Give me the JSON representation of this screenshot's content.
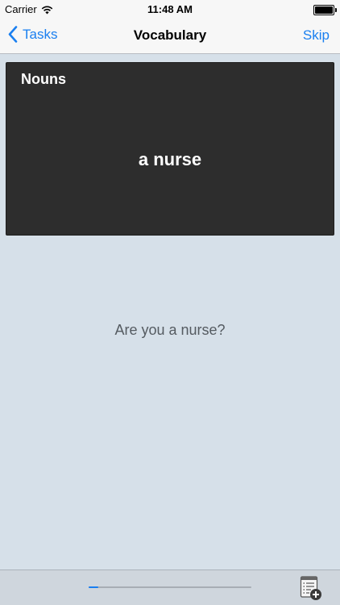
{
  "status_bar": {
    "carrier": "Carrier",
    "time": "11:48 AM",
    "battery_level": 1.0
  },
  "nav": {
    "back_label": "Tasks",
    "title": "Vocabulary",
    "skip_label": "Skip"
  },
  "card": {
    "category": "Nouns",
    "term": "a nurse"
  },
  "example_sentence": "Are you a nurse?",
  "progress": {
    "fraction": 0.06
  },
  "colors": {
    "accent": "#1a7ff0",
    "card_background": "#2d2d2d",
    "screen_background": "#d6e0e9"
  },
  "icons": {
    "back": "chevron-left-icon",
    "wifi": "wifi-icon",
    "battery": "battery-icon",
    "add_list": "add-to-list-icon"
  }
}
